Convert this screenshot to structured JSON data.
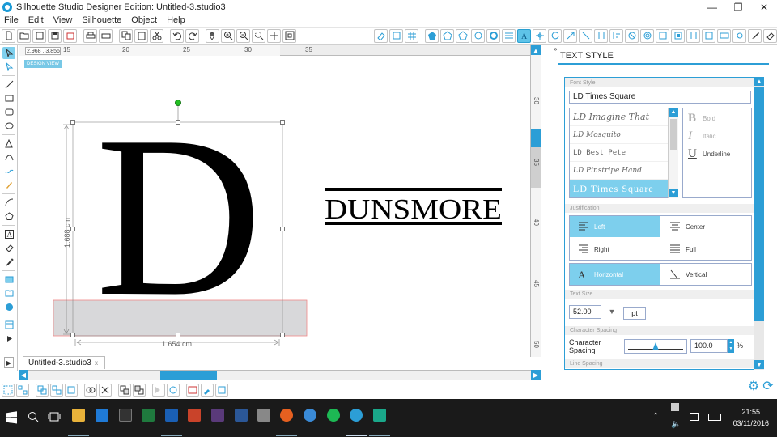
{
  "window": {
    "title": "Silhouette Studio Designer Edition: Untitled-3.studio3"
  },
  "menu": [
    "File",
    "Edit",
    "View",
    "Silhouette",
    "Object",
    "Help"
  ],
  "canvas": {
    "coords": "2.968 , 3.856",
    "design_view_label": "DESIGN VIEW",
    "ruler_h": [
      "15",
      "20",
      "25",
      "30",
      "35"
    ],
    "ruler_v": [
      "30",
      "35",
      "40",
      "45",
      "50"
    ],
    "big_letter": "D",
    "logo_text": "DUNSMORE",
    "width_dim": "1.654 cm",
    "height_dim": "1.688 cm"
  },
  "document_tab": {
    "label": "Untitled-3.studio3",
    "close": "x"
  },
  "panel": {
    "title": "TEXT STYLE",
    "font_style_header": "Font Style",
    "font_name": "LD Times Square",
    "fonts": [
      "LD Imagine That",
      "LD Mosquito",
      "LD Best Pete",
      "LD Pinstripe Hand",
      "LD Times Square"
    ],
    "selected_font_index": 4,
    "styles": {
      "bold": "Bold",
      "italic": "Italic",
      "underline": "Underline"
    },
    "justification_header": "Justification",
    "justification": {
      "left": "Left",
      "center": "Center",
      "right": "Right",
      "full": "Full"
    },
    "orientation": {
      "horizontal": "Horizontal",
      "vertical": "Vertical"
    },
    "text_size_header": "Text Size",
    "text_size_value": "52.00",
    "text_size_unit": "pt",
    "char_spacing_header": "Character Spacing",
    "char_spacing_label": "Character Spacing",
    "char_spacing_value": "100.0",
    "char_spacing_unit": "%",
    "line_spacing_header": "Line Spacing"
  },
  "taskbar": {
    "time": "21:55",
    "date": "03/11/2016"
  }
}
